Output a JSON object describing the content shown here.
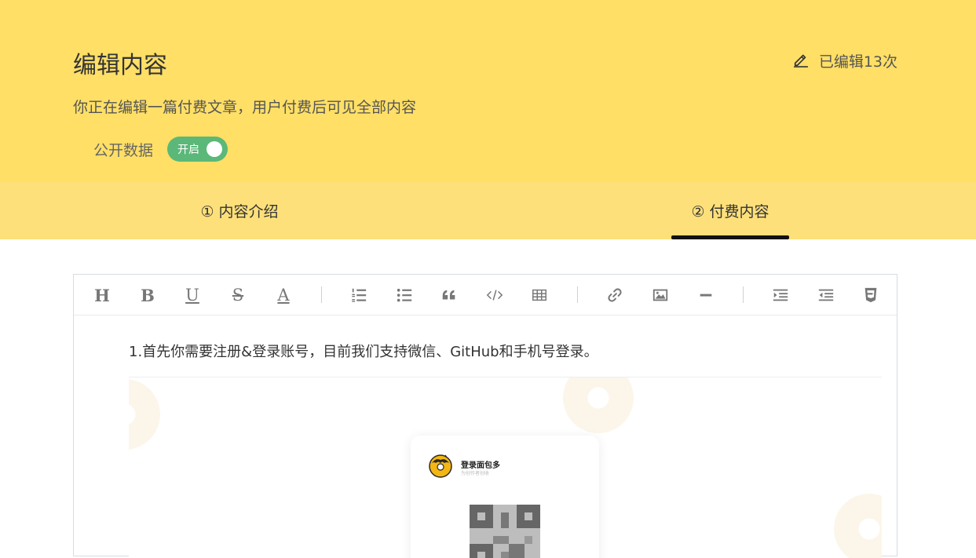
{
  "hero": {
    "title": "编辑内容",
    "edit_count": "已编辑13次",
    "subtitle": "你正在编辑一篇付费文章，用户付费后可见全部内容",
    "public_label": "公开数据",
    "toggle_label": "开启",
    "toggle_on": true,
    "bg_color": "#ffdf66",
    "toggle_color": "#5bb878"
  },
  "tabs": [
    {
      "label": "① 内容介绍",
      "active": false
    },
    {
      "label": "② 付费内容",
      "active": true
    }
  ],
  "toolbar": {
    "heading": "H",
    "bold": "B",
    "underline": "U",
    "strike": "S",
    "font_color": "A",
    "icons": [
      "ordered-list-icon",
      "unordered-list-icon",
      "quote-icon",
      "code-icon",
      "table-icon",
      "link-icon",
      "image-icon",
      "horizontal-rule-icon",
      "indent-icon",
      "outdent-icon",
      "html5-icon"
    ]
  },
  "editor": {
    "paragraph": "1.首先你需要注册&登录账号，目前我们支持微信、GitHub和手机号登录。",
    "card_title": "登录面包多",
    "card_subtitle": "为创作者创收"
  }
}
